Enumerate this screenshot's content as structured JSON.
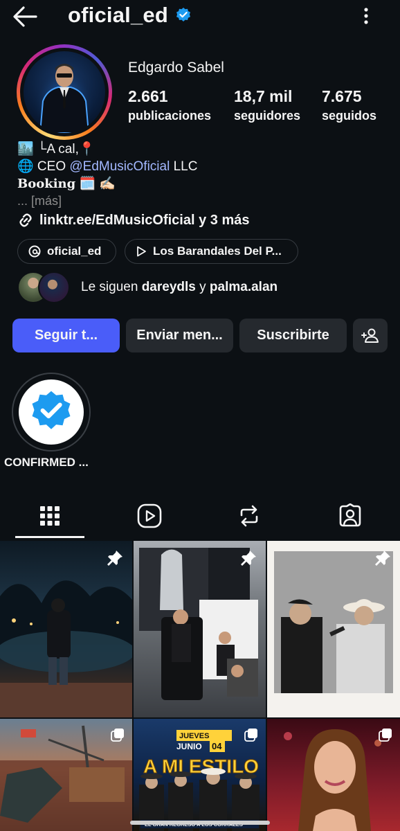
{
  "header": {
    "back_icon": "arrow-left-icon",
    "username": "oficial_ed",
    "verified_icon": "verified-badge-icon",
    "menu_icon": "more-vertical-icon"
  },
  "profile": {
    "display_name": "Edgardo Sabel",
    "stats": [
      {
        "value": "2.661",
        "label": "publicaciones"
      },
      {
        "value": "18,7 mil",
        "label": "seguidores"
      },
      {
        "value": "7.675",
        "label": "seguidos"
      }
    ]
  },
  "bio": {
    "line1": "🏙️ └A cal,📍",
    "line2_prefix": "🌐 CEO ",
    "line2_mention": "@EdMusicOficial",
    "line2_suffix": " LLC",
    "line3_booking": "Booking",
    "line3_emoji": " 🗓️ ✍🏻",
    "more": "... [más]",
    "link": "linktr.ee/EdMusicOficial y 3 más"
  },
  "chips": [
    {
      "label": "oficial_ed",
      "icon": "threads-icon"
    },
    {
      "label": "Los Barandales Del P...",
      "icon": "play-icon"
    }
  ],
  "followed_by": {
    "prefix": "Le siguen ",
    "user1": "dareydls",
    "joiner": " y ",
    "user2": "palma.alan"
  },
  "buttons": {
    "follow": "Seguir t...",
    "message": "Enviar men...",
    "subscribe": "Suscribirte",
    "add_person_icon": "add-person-icon"
  },
  "highlight": {
    "label": "CONFIRMED ..."
  },
  "tabs": [
    {
      "name": "grid",
      "icon": "grid-icon",
      "active": true
    },
    {
      "name": "reels",
      "icon": "reels-icon",
      "active": false
    },
    {
      "name": "reposts",
      "icon": "repost-icon",
      "active": false
    },
    {
      "name": "tagged",
      "icon": "tagged-icon",
      "active": false
    }
  ],
  "posts": [
    {
      "pinned": true
    },
    {
      "pinned": true
    },
    {
      "pinned": true
    },
    {
      "pinned": false,
      "multi": true
    },
    {
      "pinned": false,
      "multi": true,
      "overlay_text": [
        "JUEVES",
        "JUNIO",
        "04",
        "A MI ESTILO",
        "EL GRAN REGRESO A LOS CORRALES"
      ]
    },
    {
      "pinned": false,
      "multi": true
    }
  ],
  "colors": {
    "background": "#0c1014",
    "primary_button": "#4a5df9",
    "secondary_button": "#25292e",
    "mention": "#a3b8ff",
    "verified": "#1d9bf0"
  }
}
